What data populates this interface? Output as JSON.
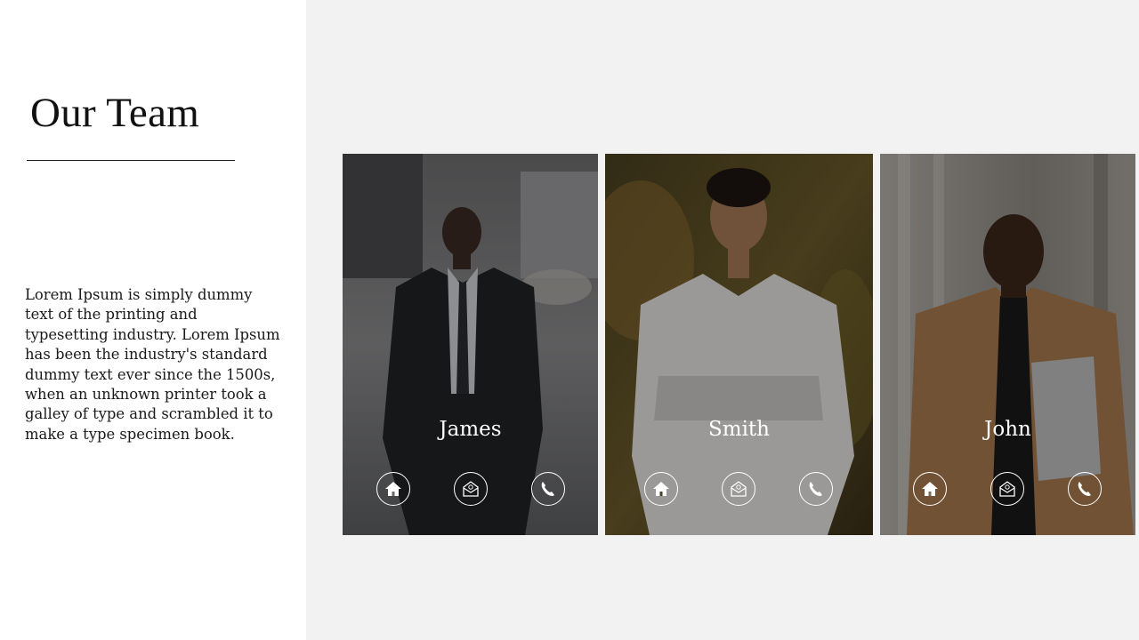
{
  "page": {
    "title": "Our Team",
    "description": "Lorem Ipsum is simply dummy text of the printing and typesetting industry. Lorem Ipsum has been the industry's standard dummy text ever since the 1500s, when an unknown printer took a galley of type and scrambled it to make a type specimen book."
  },
  "team": [
    {
      "name": "James",
      "icons": [
        "home-icon",
        "mail-icon",
        "phone-icon"
      ]
    },
    {
      "name": "Smith",
      "icons": [
        "home-icon",
        "mail-icon",
        "phone-icon"
      ]
    },
    {
      "name": "John",
      "icons": [
        "home-icon",
        "mail-icon",
        "phone-icon"
      ]
    }
  ],
  "colors": {
    "background": "#f2f2f2",
    "panel": "#ffffff",
    "text": "#111111",
    "card_text": "#ffffff"
  }
}
